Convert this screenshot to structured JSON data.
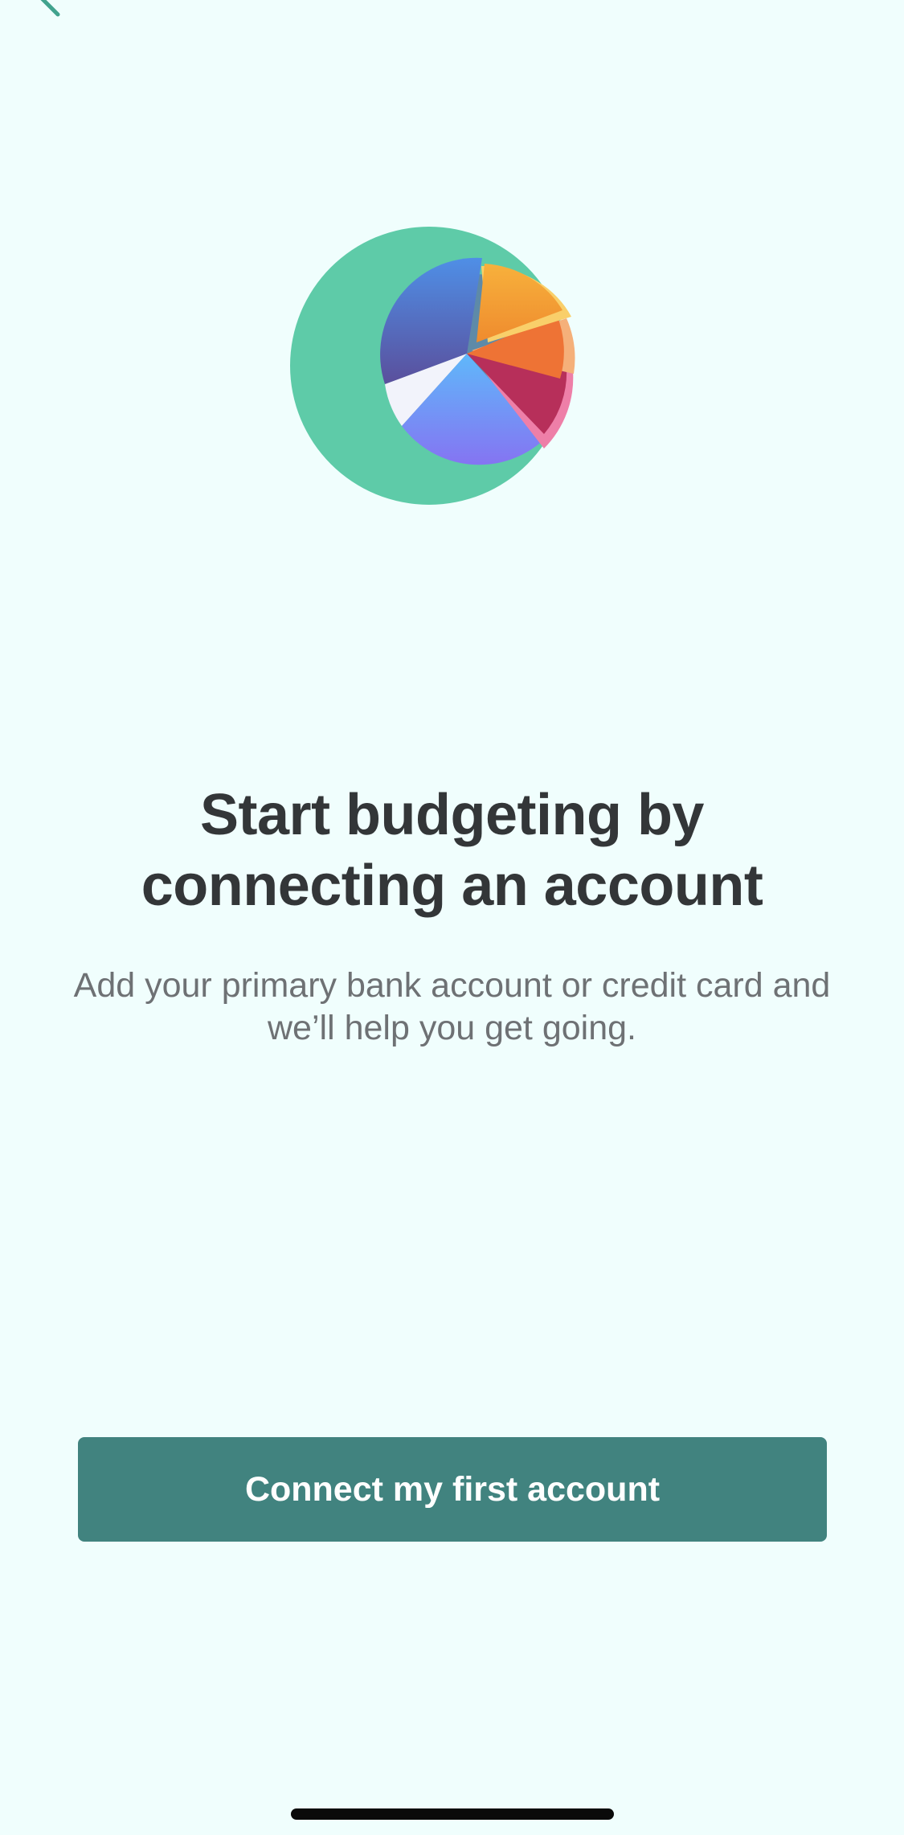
{
  "nav": {
    "back_icon": "chevron-left-icon"
  },
  "illustration": {
    "icon": "pie-chart-icon"
  },
  "content": {
    "headline_line1": "Start budgeting by",
    "headline_line2": "connecting an account",
    "subtext_line1": "Add your primary bank account or credit card and",
    "subtext_line2": "we’ll help you get going."
  },
  "cta": {
    "label": "Connect my first account"
  },
  "colors": {
    "background": "#F0FEFD",
    "accent_green": "#5ECBA8",
    "button": "#41837F",
    "headline": "#333638",
    "subtext": "#6E7174"
  }
}
